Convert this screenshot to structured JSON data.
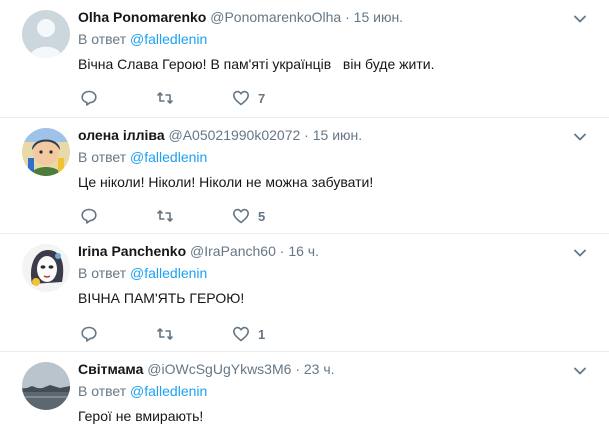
{
  "tweets": [
    {
      "name": "Olha Ponomarenko",
      "handle": "@PonomarenkoOlha",
      "separator": "·",
      "time": "15 июн.",
      "reply_prefix": "В ответ",
      "reply_mention": "@falledlenin",
      "text": "Вічна Слава Герою! В пам'яті українців   він буде жити.",
      "likes": "7",
      "avatar_icon": "default-avatar-silhouette"
    },
    {
      "name": "олена ілліва",
      "handle": "@A05021990k02072",
      "separator": "·",
      "time": "15 июн.",
      "reply_prefix": "В ответ",
      "reply_mention": "@falledlenin",
      "text": "Це ніколи! Ніколи! Ніколи не можна забувати!",
      "likes": "5",
      "avatar_icon": "cartoon-girl-avatar"
    },
    {
      "name": "Irina Panchenko",
      "handle": "@IraPanch60",
      "separator": "·",
      "time": "16 ч.",
      "reply_prefix": "В ответ",
      "reply_mention": "@falledlenin",
      "text": "ВІЧНА ПАМ'ЯТЬ ГЕРОЮ!",
      "likes": "1",
      "avatar_icon": "drawn-face-avatar"
    },
    {
      "name": "Світмама",
      "handle": "@iOWcSgUgYkws3M6",
      "separator": "·",
      "time": "23 ч.",
      "reply_prefix": "В ответ",
      "reply_mention": "@falledlenin",
      "text": "Герої не вмирають!",
      "likes": "",
      "avatar_icon": "landscape-photo-avatar"
    }
  ],
  "colors": {
    "text": "#14171a",
    "secondary": "#657786",
    "link": "#1da1f2",
    "divider": "#e6ecf0"
  }
}
